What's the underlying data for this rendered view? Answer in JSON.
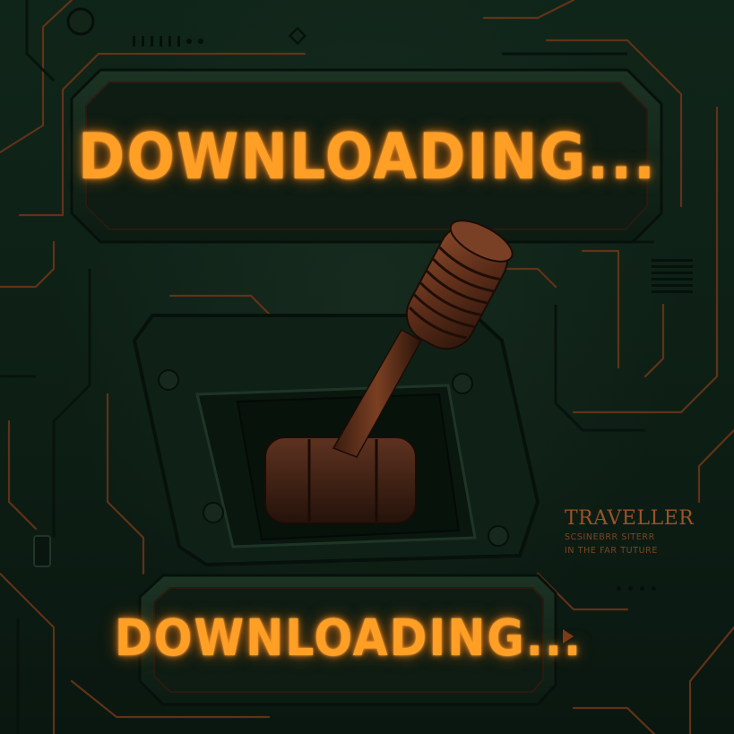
{
  "screen": {
    "display_text": "DOWNLOADING...",
    "secondary_display_text": "DOWNLOADING..."
  },
  "brand": {
    "title": "TRAVELLER",
    "subtitle_line1": "SCSINEBRR SITERR",
    "subtitle_line2": "IN THE FAR TUTURE"
  },
  "colors": {
    "accent": "#ff9f26",
    "panel": "#0f2217",
    "trace": "#7a3a18",
    "lever": "#5a2e1a"
  },
  "icons": [
    "lever-handle-icon",
    "screw-icon",
    "vent-icon",
    "grille-icon",
    "arrow-right-icon"
  ]
}
